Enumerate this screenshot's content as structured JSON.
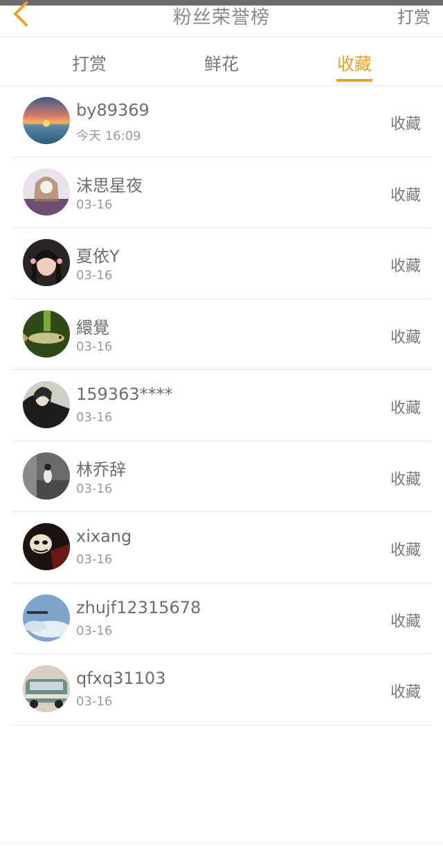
{
  "header": {
    "title": "粉丝荣誉榜",
    "right_label": "打赏",
    "back_icon": "chevron-left-icon"
  },
  "tabs": [
    {
      "label": "打赏",
      "active": false
    },
    {
      "label": "鲜花",
      "active": false
    },
    {
      "label": "收藏",
      "active": true
    }
  ],
  "accent_color": "#f0a020",
  "fans": [
    {
      "name": "by89369",
      "time": "今天 16:09",
      "action": "收藏"
    },
    {
      "name": "沫思星夜",
      "time": "03-16",
      "action": "收藏"
    },
    {
      "name": "夏依Y",
      "time": "03-16",
      "action": "收藏"
    },
    {
      "name": "繯覺",
      "time": "03-16",
      "action": "收藏"
    },
    {
      "name": "159363****",
      "time": "03-16",
      "action": "收藏"
    },
    {
      "name": "林乔辞",
      "time": "03-16",
      "action": "收藏"
    },
    {
      "name": "xixang",
      "time": "03-16",
      "action": "收藏"
    },
    {
      "name": "zhujf12315678",
      "time": "03-16",
      "action": "收藏"
    },
    {
      "name": "qfxq31103",
      "time": "03-16",
      "action": "收藏"
    }
  ]
}
